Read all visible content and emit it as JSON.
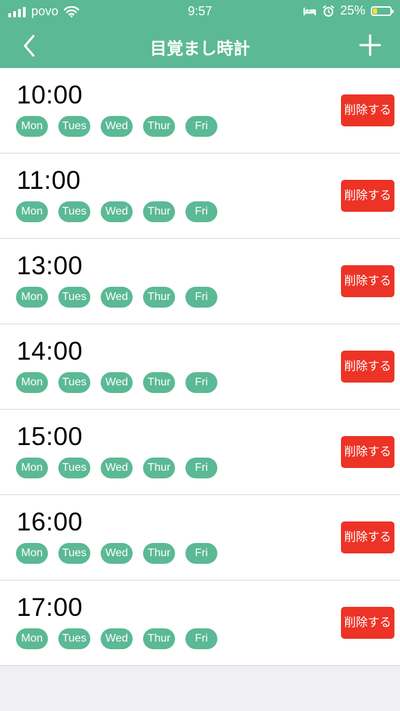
{
  "status_bar": {
    "carrier": "povo",
    "time": "9:57",
    "battery_percent": "25%",
    "battery_level": 0.25,
    "icons": [
      "signal-bars-icon",
      "wifi-icon",
      "sleep-bed-icon",
      "alarm-clock-icon",
      "battery-icon"
    ]
  },
  "header": {
    "title": "目覚まし時計",
    "back_icon": "chevron-left-icon",
    "add_icon": "plus-icon"
  },
  "alarms": [
    {
      "time": "10:00",
      "days": [
        "Mon",
        "Tues",
        "Wed",
        "Thur",
        "Fri"
      ],
      "delete_label": "削除する"
    },
    {
      "time": "11:00",
      "days": [
        "Mon",
        "Tues",
        "Wed",
        "Thur",
        "Fri"
      ],
      "delete_label": "削除する"
    },
    {
      "time": "13:00",
      "days": [
        "Mon",
        "Tues",
        "Wed",
        "Thur",
        "Fri"
      ],
      "delete_label": "削除する"
    },
    {
      "time": "14:00",
      "days": [
        "Mon",
        "Tues",
        "Wed",
        "Thur",
        "Fri"
      ],
      "delete_label": "削除する"
    },
    {
      "time": "15:00",
      "days": [
        "Mon",
        "Tues",
        "Wed",
        "Thur",
        "Fri"
      ],
      "delete_label": "削除する"
    },
    {
      "time": "16:00",
      "days": [
        "Mon",
        "Tues",
        "Wed",
        "Thur",
        "Fri"
      ],
      "delete_label": "削除する"
    },
    {
      "time": "17:00",
      "days": [
        "Mon",
        "Tues",
        "Wed",
        "Thur",
        "Fri"
      ],
      "delete_label": "削除する"
    }
  ],
  "colors": {
    "accent": "#5bb995",
    "delete": "#ec3326",
    "background": "#efeff4"
  }
}
